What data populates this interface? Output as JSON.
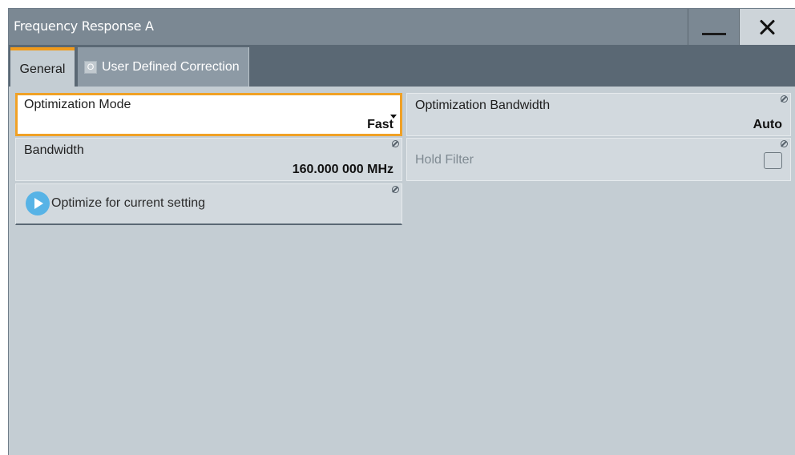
{
  "window": {
    "title": "Frequency Response A",
    "minimize_icon": "minimize-icon",
    "close_icon": "close-icon"
  },
  "tabs": [
    {
      "label": "General",
      "active": true
    },
    {
      "label": "User Defined Correction",
      "state_indicator": "O",
      "active": false
    }
  ],
  "general": {
    "optimization_mode": {
      "label": "Optimization Mode",
      "value": "Fast",
      "focused": true
    },
    "optimization_bandwidth": {
      "label": "Optimization Bandwidth",
      "value": "Auto"
    },
    "bandwidth": {
      "label": "Bandwidth",
      "value": "160.000 000 MHz"
    },
    "hold_filter": {
      "label": "Hold Filter",
      "checked": false,
      "enabled": false
    },
    "optimize_button": {
      "label": "Optimize for current setting",
      "icon": "play-icon"
    }
  },
  "colors": {
    "accent_orange": "#f09b1d",
    "titlebar": "#7b8893",
    "tabstrip": "#5a6874",
    "panel_bg": "#c4cdd3",
    "play_blue": "#57b3e6"
  }
}
